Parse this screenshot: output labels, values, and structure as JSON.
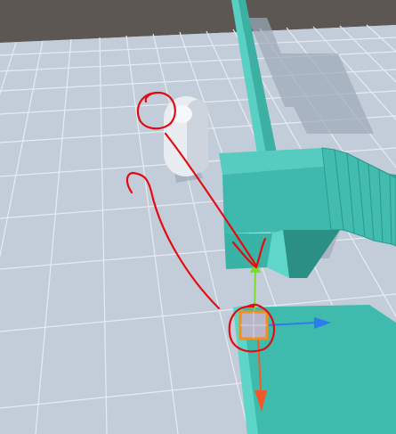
{
  "scene": {
    "sky_color": "#5c5753",
    "ground_color": "#c3cdd9",
    "grid_color": "#e6ebf1",
    "geometry_color": "#45c3b7",
    "geometry_shadow_color": "#2a9a8f",
    "capsule_color": "#e9edf2",
    "annotation_color": "#e30b12"
  },
  "gizmo": {
    "y_axis_color": "#79dd2a",
    "x_axis_color": "#2c7bf0",
    "z_axis_color": "#f05a2b",
    "selection_color": "#f28e1c"
  },
  "annotations": [
    "circle-on-player-capsule",
    "arrow-to-gizmo",
    "curved-arrow-back",
    "circle-on-gizmo"
  ]
}
